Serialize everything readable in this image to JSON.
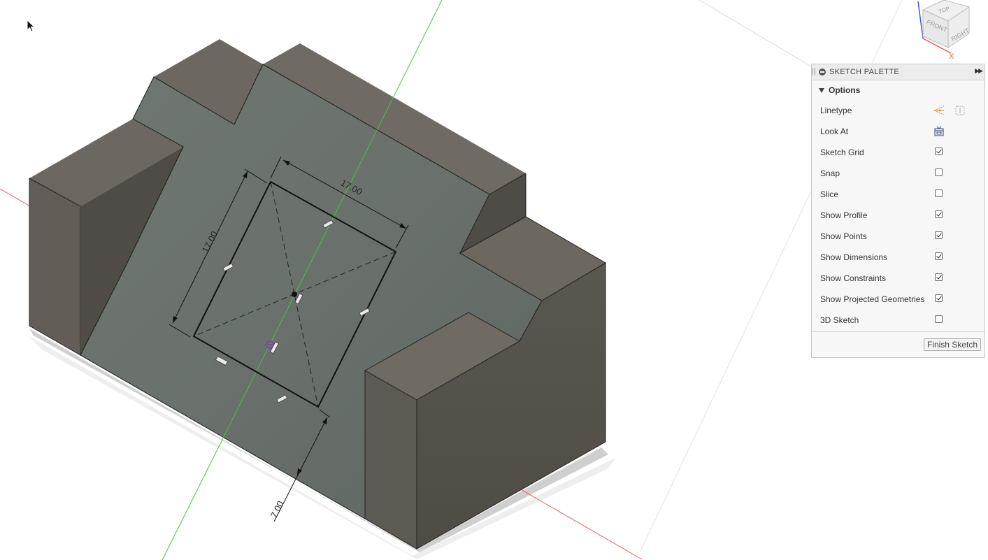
{
  "viewport": {
    "dimensions": {
      "top": "17.00",
      "left": "17.00",
      "bottom": "7.00"
    },
    "viewcube": {
      "top": "TOP",
      "front": "FRONT",
      "right": "RIGHT",
      "axis_x": "X"
    }
  },
  "palette": {
    "title": "SKETCH PALETTE",
    "section": "Options",
    "rows": [
      {
        "label": "Linetype",
        "type": "icons"
      },
      {
        "label": "Look At",
        "type": "icon"
      },
      {
        "label": "Sketch Grid",
        "checked": true
      },
      {
        "label": "Snap",
        "checked": false
      },
      {
        "label": "Slice",
        "checked": false
      },
      {
        "label": "Show Profile",
        "checked": true
      },
      {
        "label": "Show Points",
        "checked": true
      },
      {
        "label": "Show Dimensions",
        "checked": true
      },
      {
        "label": "Show Constraints",
        "checked": true
      },
      {
        "label": "Show Projected Geometries",
        "checked": true
      },
      {
        "label": "3D Sketch",
        "checked": false
      }
    ],
    "finish_label": "Finish Sketch"
  }
}
